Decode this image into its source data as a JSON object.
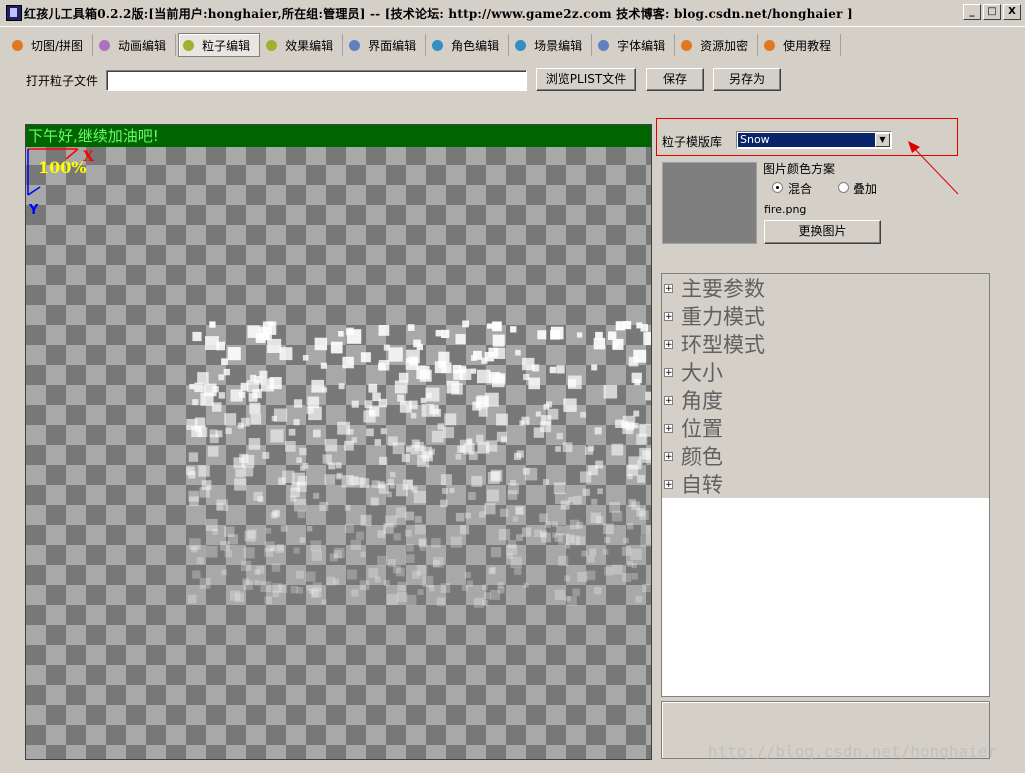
{
  "window": {
    "title": "红孩儿工具箱0.2.2版:[当前用户:honghaier,所在组:管理员]  --  [技术论坛: http://www.game2z.com 技术博客: blog.csdn.net/honghaier ]",
    "min_glyph": "_",
    "max_glyph": "□",
    "close_glyph": "X"
  },
  "toolbar": {
    "items": [
      {
        "label": "切图/拼图",
        "color": "#e07820"
      },
      {
        "label": "动画编辑",
        "color": "#b070c0"
      },
      {
        "label": "粒子编辑",
        "color": "#a0b030",
        "active": true
      },
      {
        "label": "效果编辑",
        "color": "#a0b030"
      },
      {
        "label": "界面编辑",
        "color": "#6080c0"
      },
      {
        "label": "角色编辑",
        "color": "#3090c0"
      },
      {
        "label": "场景编辑",
        "color": "#3090c0"
      },
      {
        "label": "字体编辑",
        "color": "#6080c0"
      },
      {
        "label": "资源加密",
        "color": "#e07820"
      },
      {
        "label": "使用教程",
        "color": "#e07820"
      }
    ]
  },
  "file_row": {
    "open_label": "打开粒子文件",
    "path_value": "",
    "browse_label": "浏览PLIST文件",
    "save_label": "保存",
    "save_as_label": "另存为"
  },
  "canvas": {
    "greeting": "下午好,继续加油吧!",
    "zoom": "100%",
    "x_axis": "X",
    "y_axis": "Y"
  },
  "template": {
    "label": "粒子模版库",
    "selected": "Snow"
  },
  "image_scheme": {
    "title": "图片颜色方案",
    "option_blend": "混合",
    "option_add": "叠加",
    "selected": "blend",
    "filename": "fire.png",
    "change_label": "更换图片"
  },
  "properties": {
    "groups": [
      "主要参数",
      "重力模式",
      "环型模式",
      "大小",
      "角度",
      "位置",
      "颜色",
      "自转"
    ]
  },
  "watermark": "http://blog.csdn.net/honghaier"
}
